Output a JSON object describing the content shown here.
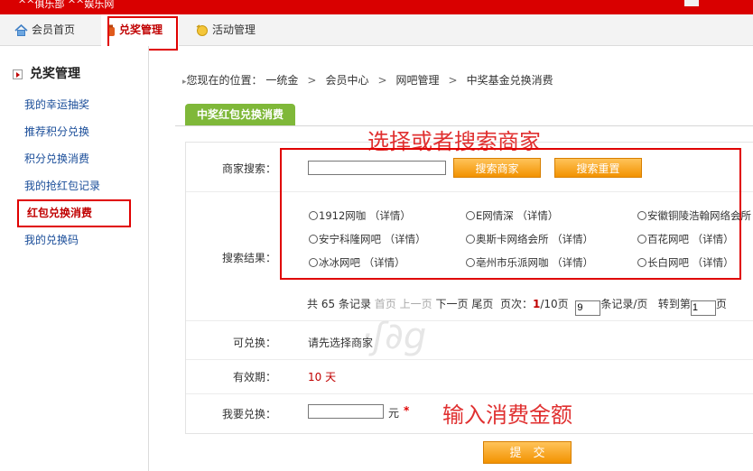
{
  "topbar": {
    "text": "^^俱乐部  ^^娱乐网"
  },
  "nav": {
    "items": [
      {
        "label": "会员首页"
      },
      {
        "label": "兑奖管理"
      },
      {
        "label": "活动管理"
      }
    ]
  },
  "sidebar": {
    "title": "兑奖管理",
    "items": [
      {
        "label": "我的幸运抽奖"
      },
      {
        "label": "推荐积分兑换"
      },
      {
        "label": "积分兑换消费"
      },
      {
        "label": "我的抢红包记录"
      },
      {
        "label": "红包兑换消费"
      },
      {
        "label": "我的兑换码"
      }
    ]
  },
  "breadcrumb": {
    "prefix": "您现在的位置：",
    "items": [
      "一统金",
      "会员中心",
      "网吧管理",
      "中奖基金兑换消费"
    ],
    "separator": ">"
  },
  "tab": {
    "label": "中奖红包兑换消费"
  },
  "annotations": {
    "search": "选择或者搜索商家",
    "amount": "输入消费金额"
  },
  "form": {
    "search_label": "商家搜索：",
    "search_value": "",
    "search_button": "搜索商家",
    "reset_button": "搜索重置",
    "results_label": "搜索结果：",
    "merchants": [
      "1912网咖 （详情）",
      "E网情深 （详情）",
      "安徽铜陵浩翰网络会所",
      "安宁科隆网吧 （详情）",
      "奥斯卡网络会所 （详情）",
      "百花网吧 （详情）",
      "冰冰网吧 （详情）",
      "亳州市乐派网咖 （详情）",
      "长白网吧 （详情）"
    ],
    "pager": {
      "total_prefix": "共",
      "total": "65",
      "total_suffix": "条记录",
      "first": "首页",
      "prev": "上一页",
      "next": "下一页",
      "last": "尾页",
      "page_label": "页次：",
      "page_current": "1",
      "page_total": "/10页",
      "per_page": "9",
      "per_page_suffix": "条记录/页",
      "goto_label": "转到第",
      "goto_value": "1",
      "goto_suffix": "页"
    },
    "redeemable_label": "可兑换：",
    "redeemable_value": "请先选择商家",
    "validity_label": "有效期：",
    "validity_value": "10 天",
    "amount_label": "我要兑换：",
    "amount_value": "",
    "amount_unit": "元",
    "required_mark": "*",
    "submit_button": "提　交"
  },
  "colors": {
    "brand_red": "#d90000",
    "tab_green": "#7fb839",
    "button_orange": "#f29200",
    "link_blue": "#1a4d99"
  }
}
